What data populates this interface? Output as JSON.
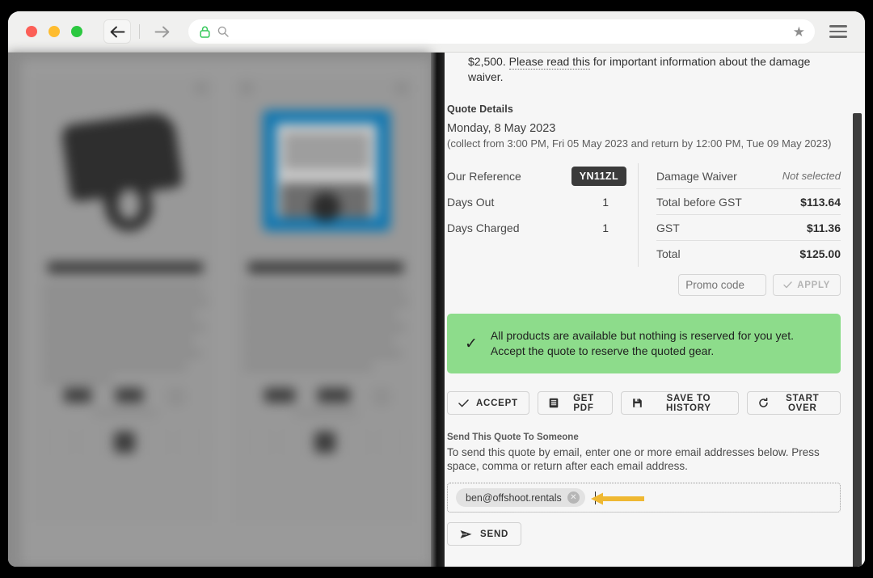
{
  "browser": {
    "traffic_lights": [
      "close",
      "minimize",
      "maximize"
    ],
    "back_label": "←",
    "forward_label": "→",
    "url_value": "",
    "url_placeholder": "",
    "lock_icon": "padlock-secure-icon",
    "search_icon": "search-icon",
    "bookmark_icon": "star-icon",
    "menu_icon": "hamburger-menu-icon"
  },
  "quote": {
    "waiver_prefix": "$2,500. ",
    "waiver_link": "Please read this",
    "waiver_suffix": " for important information about the damage waiver.",
    "section_label": "Quote Details",
    "date": "Monday, 8 May 2023",
    "window": "(collect from 3:00 PM, Fri 05 May 2023 and return by 12:00 PM, Tue 09 May 2023)",
    "left_rows": [
      {
        "label": "Our Reference",
        "value": "YN11ZL",
        "is_badge": true
      },
      {
        "label": "Days Out",
        "value": "1",
        "is_badge": false
      },
      {
        "label": "Days Charged",
        "value": "1",
        "is_badge": false
      }
    ],
    "right_rows": [
      {
        "label": "Damage Waiver",
        "value": "Not selected",
        "muted": true
      },
      {
        "label": "Total before GST",
        "value": "$113.64",
        "muted": false
      },
      {
        "label": "GST",
        "value": "$11.36",
        "muted": false
      },
      {
        "label": "Total",
        "value": "$125.00",
        "muted": false
      }
    ]
  },
  "promo": {
    "placeholder": "Promo code",
    "value": "",
    "apply_label": "APPLY",
    "apply_icon": "check-icon"
  },
  "availability": {
    "icon": "check-icon",
    "line1": "All products are available but nothing is reserved for you yet.",
    "line2": "Accept the quote to reserve the quoted gear.",
    "background": "#8ddc8b"
  },
  "actions": [
    {
      "label": "ACCEPT",
      "icon": "check-icon"
    },
    {
      "label": "GET PDF",
      "icon": "document-pdf-icon"
    },
    {
      "label": "SAVE TO HISTORY",
      "icon": "floppy-disk-save-icon"
    },
    {
      "label": "START OVER",
      "icon": "refresh-circular-arrow-icon"
    }
  ],
  "send": {
    "label": "Send This Quote To Someone",
    "description": "To send this quote by email, enter one or more email addresses below. Press space, comma or return after each email address.",
    "email_chips": [
      {
        "address": "ben@offshoot.rentals",
        "remove_icon": "close-circle-icon"
      }
    ],
    "input_value": "",
    "send_label": "SEND",
    "send_icon": "paper-plane-send-icon",
    "annotation_icon": "yellow-left-arrow-annotation",
    "annotation_color": "#efb832"
  },
  "left_panel": {
    "description": "blurred product catalogue behind the quote panel",
    "cards": [
      {
        "image": "blurred-black-product"
      },
      {
        "image": "blurred-blue-product"
      }
    ]
  }
}
